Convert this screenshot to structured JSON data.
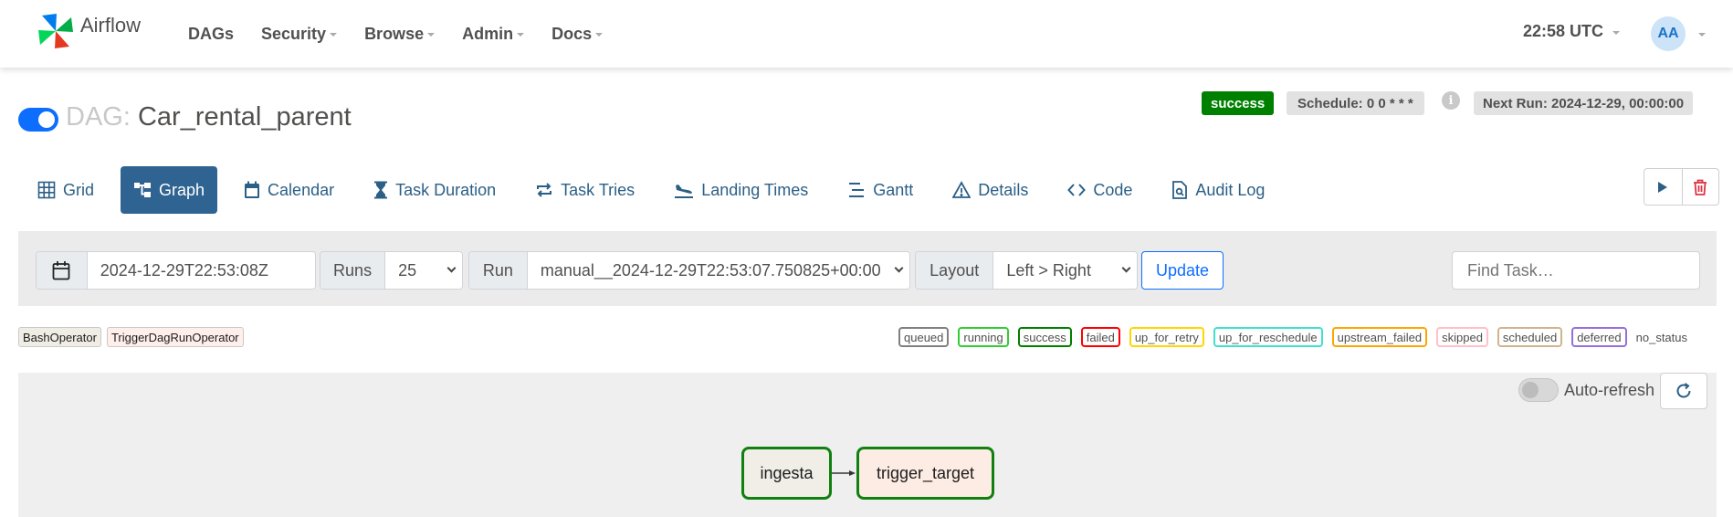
{
  "navbar": {
    "brand": "Airflow",
    "menu": [
      {
        "label": "DAGs",
        "dropdown": false
      },
      {
        "label": "Security",
        "dropdown": true
      },
      {
        "label": "Browse",
        "dropdown": true
      },
      {
        "label": "Admin",
        "dropdown": true
      },
      {
        "label": "Docs",
        "dropdown": true
      }
    ],
    "time": "22:58 UTC",
    "user_initials": "AA"
  },
  "dag": {
    "label": "DAG:",
    "name": "Car_rental_parent",
    "paused": false,
    "status": "success",
    "schedule": "Schedule: 0 0 * * *",
    "info_icon": "i",
    "next_run": "Next Run: 2024-12-29, 00:00:00"
  },
  "tabs": [
    {
      "label": "Grid",
      "icon": "grid-icon",
      "active": false
    },
    {
      "label": "Graph",
      "icon": "graph-icon",
      "active": true
    },
    {
      "label": "Calendar",
      "icon": "calendar-icon",
      "active": false
    },
    {
      "label": "Task Duration",
      "icon": "hourglass-icon",
      "active": false
    },
    {
      "label": "Task Tries",
      "icon": "repeat-icon",
      "active": false
    },
    {
      "label": "Landing Times",
      "icon": "plane-landing-icon",
      "active": false
    },
    {
      "label": "Gantt",
      "icon": "gantt-icon",
      "active": false
    },
    {
      "label": "Details",
      "icon": "warning-triangle-icon",
      "active": false
    },
    {
      "label": "Code",
      "icon": "code-icon",
      "active": false
    },
    {
      "label": "Audit Log",
      "icon": "file-search-icon",
      "active": false
    }
  ],
  "filters": {
    "base_date": "2024-12-29T22:53:08Z",
    "runs_label": "Runs",
    "runs_value": "25",
    "run_label": "Run",
    "run_value": "manual__2024-12-29T22:53:07.750825+00:00",
    "layout_label": "Layout",
    "layout_value": "Left > Right",
    "update_label": "Update",
    "find_placeholder": "Find Task…"
  },
  "operators": [
    {
      "label": "BashOperator",
      "color": "#f0ede4"
    },
    {
      "label": "TriggerDagRunOperator",
      "color": "#ffefeb"
    }
  ],
  "states": [
    {
      "label": "queued",
      "color": "#808080"
    },
    {
      "label": "running",
      "color": "#32cd32"
    },
    {
      "label": "success",
      "color": "#008000"
    },
    {
      "label": "failed",
      "color": "#ff0000"
    },
    {
      "label": "up_for_retry",
      "color": "#ffd700"
    },
    {
      "label": "up_for_reschedule",
      "color": "#40e0d0"
    },
    {
      "label": "upstream_failed",
      "color": "#ffa500"
    },
    {
      "label": "skipped",
      "color": "#ffc0cb"
    },
    {
      "label": "scheduled",
      "color": "#d2b48c"
    },
    {
      "label": "deferred",
      "color": "#9370db"
    }
  ],
  "no_status_label": "no_status",
  "graph": {
    "auto_refresh_label": "Auto-refresh",
    "auto_refresh_on": false,
    "nodes": [
      {
        "label": "ingesta",
        "state": "success",
        "operator": "BashOperator"
      },
      {
        "label": "trigger_target",
        "state": "success",
        "operator": "TriggerDagRunOperator"
      }
    ]
  }
}
